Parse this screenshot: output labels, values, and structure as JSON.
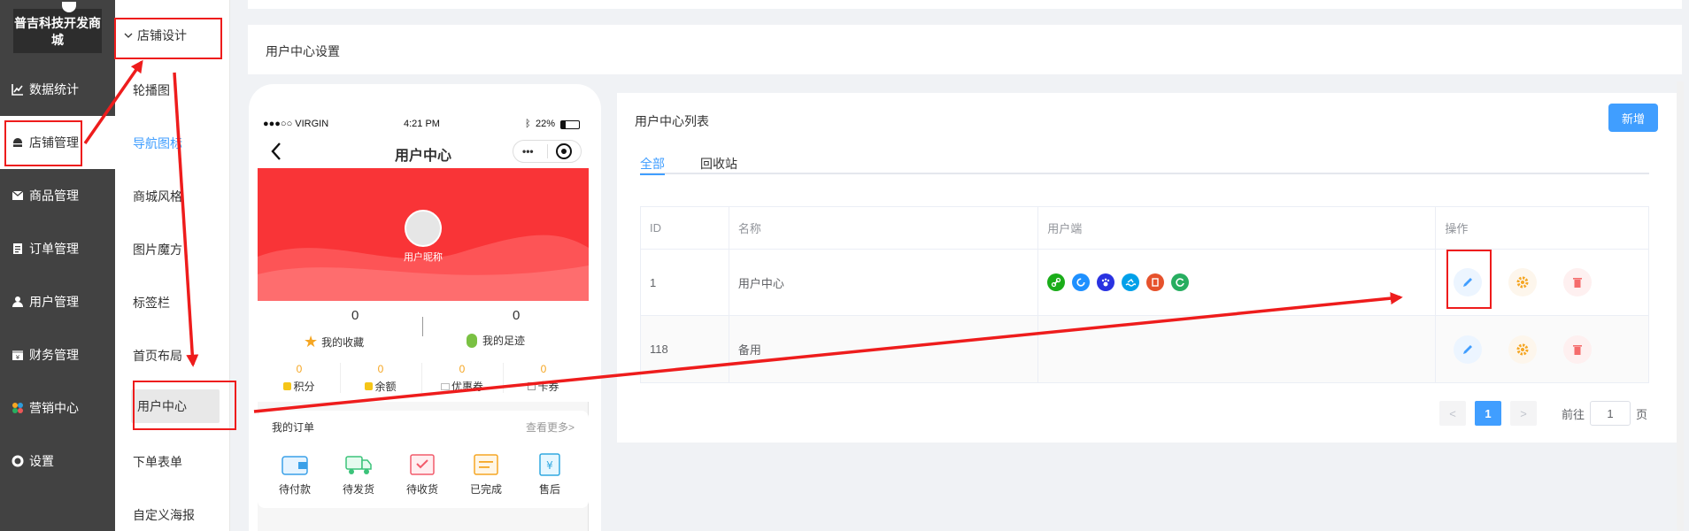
{
  "brand": {
    "name": "普吉科技开发商城"
  },
  "sidebar": {
    "items": [
      {
        "label": "数据统计",
        "icon": "chart-line-icon"
      },
      {
        "label": "店铺管理",
        "icon": "store-icon"
      },
      {
        "label": "商品管理",
        "icon": "mail-icon"
      },
      {
        "label": "订单管理",
        "icon": "document-icon"
      },
      {
        "label": "用户管理",
        "icon": "user-icon"
      },
      {
        "label": "财务管理",
        "icon": "finance-icon"
      },
      {
        "label": "营销中心",
        "icon": "marketing-icon"
      },
      {
        "label": "设置",
        "icon": "gear-icon"
      }
    ],
    "active": "店铺管理"
  },
  "submenu": {
    "group": "店铺设计",
    "items": [
      "轮播图",
      "导航图标",
      "商城风格",
      "图片魔方",
      "标签栏",
      "首页布局",
      "用户中心",
      "下单表单",
      "自定义海报"
    ],
    "active": "用户中心",
    "link": "导航图标"
  },
  "page": {
    "title": "用户中心设置"
  },
  "phone": {
    "status": {
      "carrier": "●●●○○ VIRGIN",
      "time": "4:21 PM",
      "battery": "22%"
    },
    "nav_title": "用户中心",
    "nickname": "用户昵称",
    "favorites": {
      "count": "0",
      "label": "我的收藏"
    },
    "footprint": {
      "count": "0",
      "label": "我的足迹"
    },
    "assets": [
      {
        "value": "0",
        "label": "积分"
      },
      {
        "value": "0",
        "label": "余额"
      },
      {
        "value": "0",
        "label": "优惠券"
      },
      {
        "value": "0",
        "label": "卡券"
      }
    ],
    "orders": {
      "title": "我的订单",
      "more": "查看更多>",
      "items": [
        "待付款",
        "待发货",
        "待收货",
        "已完成",
        "售后"
      ]
    }
  },
  "list": {
    "title": "用户中心列表",
    "new_button": "新增",
    "tabs": [
      "全部",
      "回收站"
    ],
    "active_tab": "全部",
    "columns": [
      "ID",
      "名称",
      "用户端",
      "操作"
    ],
    "rows": [
      {
        "id": "1",
        "name": "用户中心",
        "clients": [
          "link",
          "rotate",
          "paw",
          "swim",
          "clip",
          "refresh"
        ]
      },
      {
        "id": "118",
        "name": "备用",
        "clients": []
      }
    ],
    "client_colors": [
      "#1aad19",
      "#1e90ff",
      "#2932e1",
      "#00a0e9",
      "#e6522c",
      "#27ae60"
    ],
    "pagination": {
      "prev": "<",
      "current": "1",
      "next": ">",
      "goto_label": "前往",
      "goto_value": "1",
      "page_suffix": "页"
    }
  },
  "colors": {
    "primary": "#409eff",
    "sidebar": "#424242",
    "annotation": "#ee1c1c",
    "banner": "#f93437"
  }
}
